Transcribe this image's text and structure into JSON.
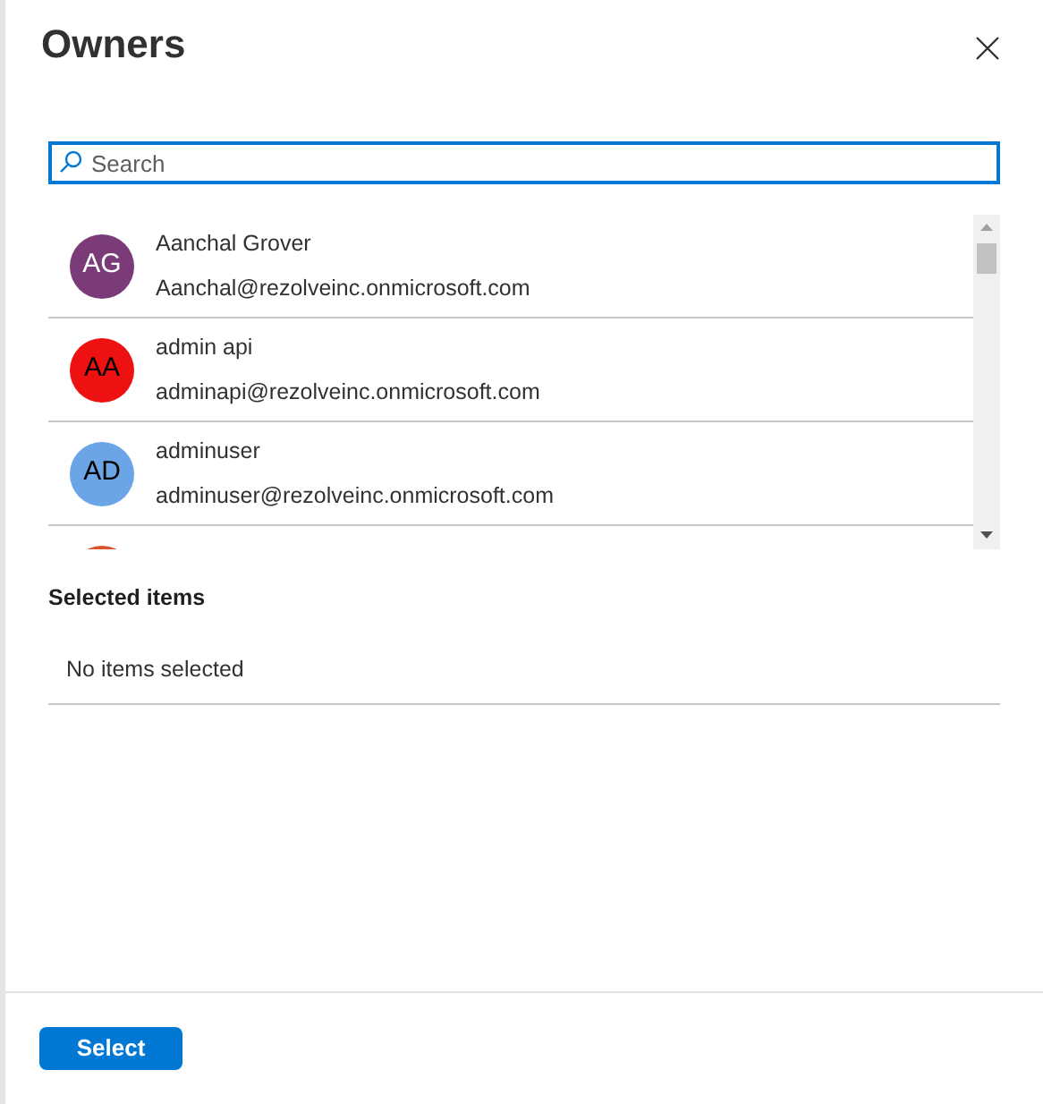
{
  "panel": {
    "title": "Owners"
  },
  "search": {
    "placeholder": "Search"
  },
  "users": [
    {
      "initials": "AG",
      "name": "Aanchal Grover",
      "email": "Aanchal@rezolveinc.onmicrosoft.com",
      "color": "#7a3b78"
    },
    {
      "initials": "AA",
      "name": "admin api",
      "email": "adminapi@rezolveinc.onmicrosoft.com",
      "color": "#ee1111"
    },
    {
      "initials": "AD",
      "name": "adminuser",
      "email": "adminuser@rezolveinc.onmicrosoft.com",
      "color": "#6ca5e6"
    },
    {
      "color": "#d9532c"
    }
  ],
  "selected_section": {
    "heading": "Selected items",
    "empty_text": "No items selected"
  },
  "footer": {
    "button": "Select"
  }
}
